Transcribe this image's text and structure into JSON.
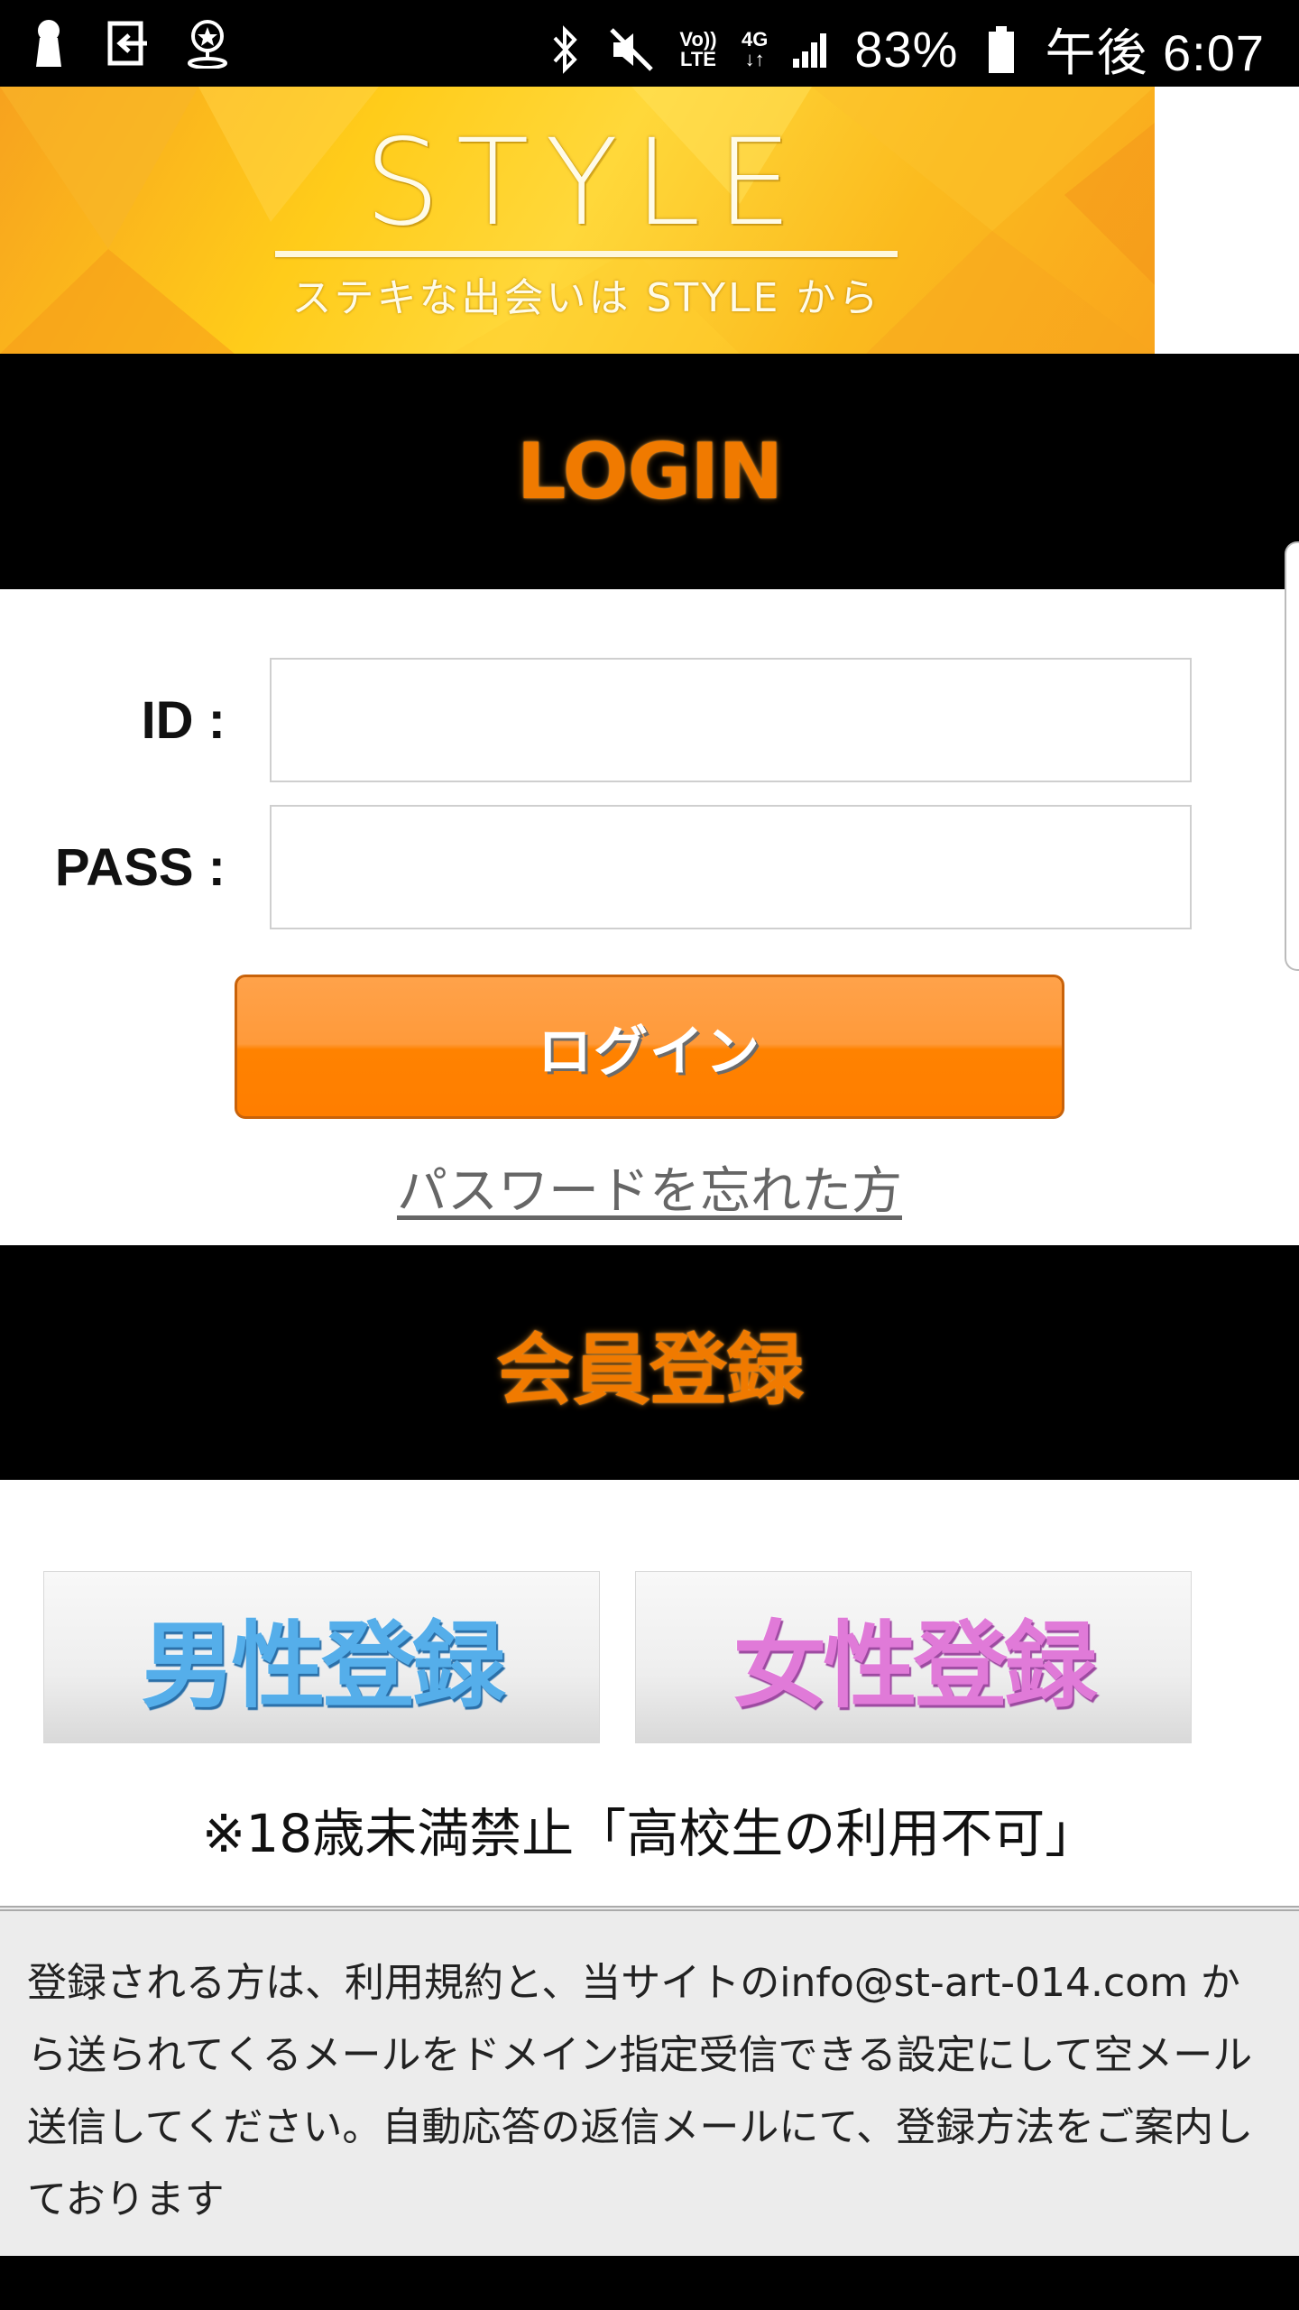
{
  "status_bar": {
    "battery": "83%",
    "time": "午後 6:07",
    "volte_label": "Vo)) LTE",
    "network": "4G",
    "icons_left": [
      "keyhole-icon",
      "exit-app-icon",
      "location-star-icon"
    ],
    "icons_right": [
      "bluetooth-icon",
      "mute-icon",
      "volte-icon",
      "network-4g-icon",
      "signal-icon",
      "battery-icon"
    ]
  },
  "banner": {
    "title": "STYLE",
    "subtitle": "ステキな出会いは STYLE から"
  },
  "login_section": {
    "header": "LOGIN",
    "id_label": "ID :",
    "id_value": "",
    "pass_label": "PASS :",
    "pass_value": "",
    "login_button": "ログイン",
    "forgot_link": "パスワードを忘れた方"
  },
  "register_section": {
    "header": "会員登録",
    "male_button": "男性登録",
    "female_button": "女性登録",
    "age_note": "※18歳未満禁止「高校生の利用不可」"
  },
  "notice": {
    "text": "登録される方は、利用規約と、当サイトのinfo@st-art-014.com から送られてくるメールをドメイン指定受信できる設定にして空メール送信してください。自動応答の返信メールにて、登録方法をご案内しております"
  },
  "colors": {
    "accent_orange": "#f07a00",
    "male_blue": "#55aeea",
    "female_pink": "#e07ad8",
    "header_bg": "#000000"
  }
}
